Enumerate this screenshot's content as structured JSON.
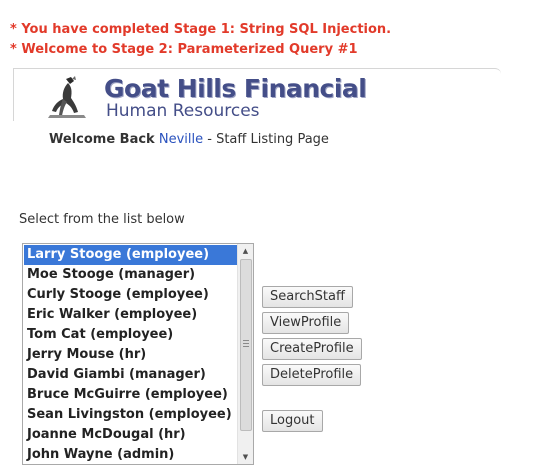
{
  "messages": [
    "* You have completed Stage 1: String SQL Injection.",
    "* Welcome to Stage 2: Parameterized Query #1"
  ],
  "brand": {
    "title": "Goat Hills Financial",
    "subtitle": "Human Resources"
  },
  "welcome": {
    "prefix": "Welcome Back",
    "user": "Neville",
    "suffix": "- Staff Listing Page"
  },
  "staff_list": {
    "label": "Select from the list below",
    "selected_index": 0,
    "items": [
      "Larry Stooge (employee)",
      "Moe Stooge (manager)",
      "Curly Stooge (employee)",
      "Eric Walker (employee)",
      "Tom Cat (employee)",
      "Jerry Mouse (hr)",
      "David Giambi (manager)",
      "Bruce McGuirre (employee)",
      "Sean Livingston (employee)",
      "Joanne McDougal (hr)",
      "John Wayne (admin)"
    ]
  },
  "buttons": {
    "search": "SearchStaff",
    "view": "ViewProfile",
    "create": "CreateProfile",
    "delete": "DeleteProfile",
    "logout": "Logout"
  },
  "colors": {
    "message": "#e23a2a",
    "brand": "#444e88",
    "user_link": "#2a52be",
    "selection": "#3a78d8"
  },
  "icons": {
    "logo": "goat-logo-icon",
    "scroll_up": "scroll-up-arrow-icon",
    "scroll_down": "scroll-down-arrow-icon"
  }
}
